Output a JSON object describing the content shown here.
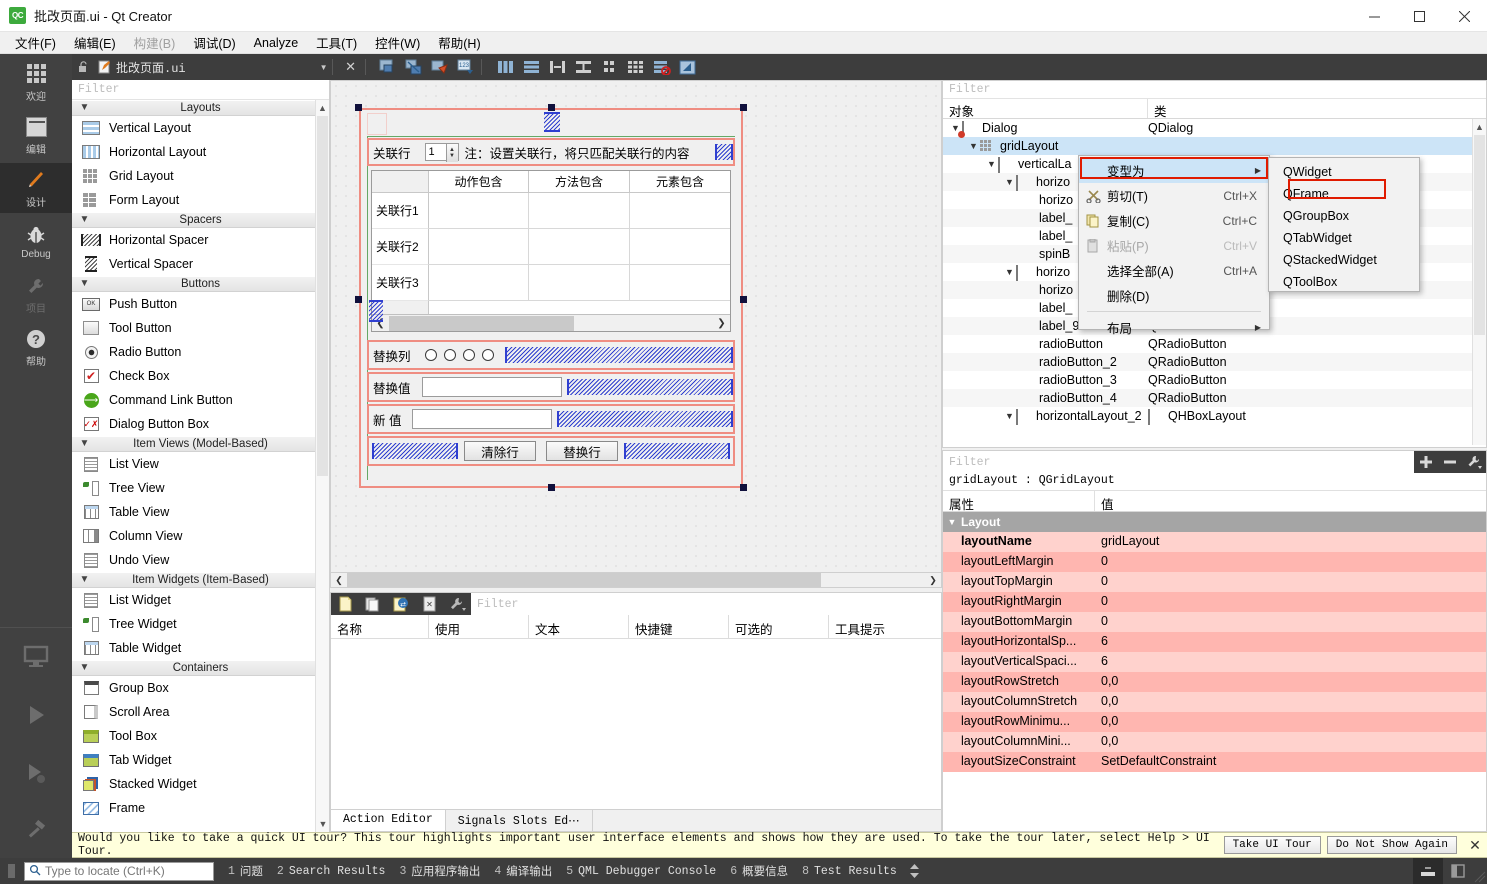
{
  "window": {
    "title": "批改页面.ui - Qt Creator",
    "logo_text": "QC",
    "minimize": "—",
    "maximize": "☐",
    "close": "✕"
  },
  "menubar": [
    {
      "label": "文件(F)",
      "disabled": false
    },
    {
      "label": "编辑(E)",
      "disabled": false
    },
    {
      "label": "构建(B)",
      "disabled": true
    },
    {
      "label": "调试(D)",
      "disabled": false
    },
    {
      "label": "Analyze",
      "disabled": false
    },
    {
      "label": "工具(T)",
      "disabled": false
    },
    {
      "label": "控件(W)",
      "disabled": false
    },
    {
      "label": "帮助(H)",
      "disabled": false
    }
  ],
  "activitybar": [
    {
      "label": "欢迎",
      "icon": "welcome-grid-icon",
      "state": "normal"
    },
    {
      "label": "编辑",
      "icon": "edit-lines-icon",
      "state": "normal"
    },
    {
      "label": "设计",
      "icon": "design-pencil-icon",
      "state": "selected"
    },
    {
      "label": "Debug",
      "icon": "debug-bug-icon",
      "state": "normal"
    },
    {
      "label": "项目",
      "icon": "projects-wrench-icon",
      "state": "dim"
    },
    {
      "label": "帮助",
      "icon": "help-question-icon",
      "state": "normal"
    }
  ],
  "activitybar_lower": [
    {
      "icon": "kit-selector-monitor-icon"
    },
    {
      "icon": "run-play-icon"
    },
    {
      "icon": "debug-start-icon"
    },
    {
      "icon": "build-hammer-icon"
    }
  ],
  "editor_toolbar": {
    "lock_icon": "lock-open-icon",
    "file_icon": "ui-file-icon",
    "filename": "批改页面.ui",
    "dropdown_icon": "chevron-down-icon",
    "close_icon": "close-icon",
    "tools": [
      "edit-widgets-icon",
      "edit-signals-slots-icon",
      "edit-buddies-icon",
      "edit-tab-order-icon",
      "layout-horizontally-icon",
      "layout-vertically-icon",
      "layout-splitter-h-icon",
      "layout-splitter-v-icon",
      "layout-form-icon",
      "layout-grid-icon",
      "break-layout-icon",
      "adjust-size-icon"
    ]
  },
  "widgetbox": {
    "filter_placeholder": "Filter",
    "groups": [
      {
        "title": "Layouts",
        "items": [
          {
            "label": "Vertical Layout",
            "icon": "vertical-layout-icon"
          },
          {
            "label": "Horizontal Layout",
            "icon": "horizontal-layout-icon"
          },
          {
            "label": "Grid Layout",
            "icon": "grid-layout-icon"
          },
          {
            "label": "Form Layout",
            "icon": "form-layout-icon"
          }
        ]
      },
      {
        "title": "Spacers",
        "items": [
          {
            "label": "Horizontal Spacer",
            "icon": "horizontal-spacer-icon"
          },
          {
            "label": "Vertical Spacer",
            "icon": "vertical-spacer-icon"
          }
        ]
      },
      {
        "title": "Buttons",
        "items": [
          {
            "label": "Push Button",
            "icon": "push-button-icon"
          },
          {
            "label": "Tool Button",
            "icon": "tool-button-icon"
          },
          {
            "label": "Radio Button",
            "icon": "radio-button-icon"
          },
          {
            "label": "Check Box",
            "icon": "check-box-icon"
          },
          {
            "label": "Command Link Button",
            "icon": "command-link-button-icon"
          },
          {
            "label": "Dialog Button Box",
            "icon": "dialog-button-box-icon"
          }
        ]
      },
      {
        "title": "Item Views (Model-Based)",
        "items": [
          {
            "label": "List View",
            "icon": "list-view-icon"
          },
          {
            "label": "Tree View",
            "icon": "tree-view-icon"
          },
          {
            "label": "Table View",
            "icon": "table-view-icon"
          },
          {
            "label": "Column View",
            "icon": "column-view-icon"
          },
          {
            "label": "Undo View",
            "icon": "undo-view-icon"
          }
        ]
      },
      {
        "title": "Item Widgets (Item-Based)",
        "items": [
          {
            "label": "List Widget",
            "icon": "list-widget-icon"
          },
          {
            "label": "Tree Widget",
            "icon": "tree-widget-icon"
          },
          {
            "label": "Table Widget",
            "icon": "table-widget-icon"
          }
        ]
      },
      {
        "title": "Containers",
        "items": [
          {
            "label": "Group Box",
            "icon": "group-box-icon"
          },
          {
            "label": "Scroll Area",
            "icon": "scroll-area-icon"
          },
          {
            "label": "Tool Box",
            "icon": "tool-box-icon"
          },
          {
            "label": "Tab Widget",
            "icon": "tab-widget-icon"
          },
          {
            "label": "Stacked Widget",
            "icon": "stacked-widget-icon"
          },
          {
            "label": "Frame",
            "icon": "frame-icon"
          }
        ]
      }
    ]
  },
  "form": {
    "row1": {
      "label": "关联行",
      "spin_value": "1",
      "note": "注：设置关联行，将只匹配关联行的内容"
    },
    "table": {
      "columns": [
        "",
        "动作包含",
        "方法包含",
        "元素包含"
      ],
      "rows": [
        "关联行1",
        "关联行2",
        "关联行3"
      ]
    },
    "replace_col": {
      "label": "替换列",
      "radio_count": 4
    },
    "replace_value": {
      "label": "替换值",
      "value": ""
    },
    "new_value": {
      "label": "新   值",
      "value": ""
    },
    "buttons": [
      {
        "label": "清除行"
      },
      {
        "label": "替换行"
      }
    ]
  },
  "action_editor": {
    "filter_placeholder": "Filter",
    "toolbar_icons": [
      "new-action-icon",
      "copy-action-icon",
      "edit-action-icon",
      "delete-action-icon",
      "view-options-icon"
    ],
    "columns": [
      "名称",
      "使用",
      "文本",
      "快捷键",
      "可选的",
      "工具提示"
    ],
    "tabs": [
      {
        "label": "Action Editor",
        "active": true
      },
      {
        "label": "Signals  Slots Ed⋯",
        "active": false
      }
    ]
  },
  "object_inspector": {
    "filter_placeholder": "Filter",
    "columns": [
      "对象",
      "类"
    ],
    "rows": [
      {
        "name": "Dialog",
        "class": "QDialog",
        "indent": 0,
        "expander": "∨",
        "icon": "dialog-icon",
        "state": "normal"
      },
      {
        "name": "gridLayout",
        "class": "",
        "indent": 1,
        "expander": "∨",
        "icon": "grid-layout-icon",
        "state": "selected"
      },
      {
        "name": "verticalLa",
        "class": "",
        "indent": 2,
        "expander": "∨",
        "icon": "vertical-layout-icon",
        "state": "normal"
      },
      {
        "name": "horizo",
        "class": "",
        "indent": 3,
        "expander": "∨",
        "icon": "horizontal-layout-icon",
        "state": "alt"
      },
      {
        "name": "horizo",
        "class": "",
        "indent": 4,
        "expander": "",
        "icon": "",
        "state": "normal"
      },
      {
        "name": "label_",
        "class": "",
        "indent": 4,
        "expander": "",
        "icon": "",
        "state": "alt"
      },
      {
        "name": "label_",
        "class": "",
        "indent": 4,
        "expander": "",
        "icon": "",
        "state": "normal"
      },
      {
        "name": "spinB",
        "class": "",
        "indent": 4,
        "expander": "",
        "icon": "",
        "state": "alt"
      },
      {
        "name": "horizo",
        "class": "",
        "indent": 3,
        "expander": "∨",
        "icon": "horizontal-layout-icon",
        "state": "normal"
      },
      {
        "name": "horizo",
        "class": "",
        "indent": 4,
        "expander": "",
        "icon": "",
        "state": "alt"
      },
      {
        "name": "label_",
        "class": "",
        "indent": 4,
        "expander": "",
        "icon": "",
        "state": "normal"
      },
      {
        "name": "label_9",
        "class": "QLabel",
        "indent": 4,
        "expander": "",
        "icon": "",
        "state": "alt"
      },
      {
        "name": "radioButton",
        "class": "QRadioButton",
        "indent": 4,
        "expander": "",
        "icon": "",
        "state": "normal"
      },
      {
        "name": "radioButton_2",
        "class": "QRadioButton",
        "indent": 4,
        "expander": "",
        "icon": "",
        "state": "alt"
      },
      {
        "name": "radioButton_3",
        "class": "QRadioButton",
        "indent": 4,
        "expander": "",
        "icon": "",
        "state": "normal"
      },
      {
        "name": "radioButton_4",
        "class": "QRadioButton",
        "indent": 4,
        "expander": "",
        "icon": "",
        "state": "alt"
      },
      {
        "name": "horizontalLayout_2",
        "class": "QHBoxLayout",
        "indent": 3,
        "expander": "∨",
        "icon": "horizontal-layout-icon",
        "state": "normal"
      }
    ]
  },
  "context_menu": {
    "items": [
      {
        "label": "变型为",
        "icon": "",
        "accel": "",
        "submenu": true,
        "highlighted": true,
        "disabled": false
      },
      {
        "label": "剪切(T)",
        "icon": "cut-scissors-icon",
        "accel": "Ctrl+X",
        "submenu": false,
        "highlighted": false,
        "disabled": false
      },
      {
        "label": "复制(C)",
        "icon": "copy-icon",
        "accel": "Ctrl+C",
        "submenu": false,
        "highlighted": false,
        "disabled": false
      },
      {
        "label": "粘贴(P)",
        "icon": "paste-icon",
        "accel": "Ctrl+V",
        "submenu": false,
        "highlighted": false,
        "disabled": true
      },
      {
        "label": "选择全部(A)",
        "icon": "",
        "accel": "Ctrl+A",
        "submenu": false,
        "highlighted": false,
        "disabled": false
      },
      {
        "label": "删除(D)",
        "icon": "",
        "accel": "",
        "submenu": false,
        "highlighted": false,
        "disabled": false
      },
      {
        "label": "布局",
        "icon": "",
        "accel": "",
        "submenu": true,
        "highlighted": false,
        "disabled": false
      }
    ],
    "submenu_items": [
      {
        "label": "QWidget",
        "highlighted": false
      },
      {
        "label": "QFrame",
        "highlighted": true
      },
      {
        "label": "QGroupBox",
        "highlighted": false
      },
      {
        "label": "QTabWidget",
        "highlighted": false
      },
      {
        "label": "QStackedWidget",
        "highlighted": false
      },
      {
        "label": "QToolBox",
        "highlighted": false
      }
    ],
    "highlight_color": "#e01b00"
  },
  "property_editor": {
    "filter_placeholder": "Filter",
    "add_icon": "plus-icon",
    "remove_icon": "minus-icon",
    "config_icon": "wrench-icon",
    "object_line": "gridLayout : QGridLayout",
    "columns": [
      "属性",
      "值"
    ],
    "group": "Layout",
    "rows": [
      {
        "key": "layoutName",
        "value": "gridLayout",
        "bold": true
      },
      {
        "key": "layoutLeftMargin",
        "value": "0",
        "bold": false
      },
      {
        "key": "layoutTopMargin",
        "value": "0",
        "bold": false
      },
      {
        "key": "layoutRightMargin",
        "value": "0",
        "bold": false
      },
      {
        "key": "layoutBottomMargin",
        "value": "0",
        "bold": false
      },
      {
        "key": "layoutHorizontalSp...",
        "value": "6",
        "bold": false
      },
      {
        "key": "layoutVerticalSpaci...",
        "value": "6",
        "bold": false
      },
      {
        "key": "layoutRowStretch",
        "value": "0,0",
        "bold": false
      },
      {
        "key": "layoutColumnStretch",
        "value": "0,0",
        "bold": false
      },
      {
        "key": "layoutRowMinimu...",
        "value": "0,0",
        "bold": false
      },
      {
        "key": "layoutColumnMini...",
        "value": "0,0",
        "bold": false
      },
      {
        "key": "layoutSizeConstraint",
        "value": "SetDefaultConstraint",
        "bold": false
      }
    ]
  },
  "tour_bar": {
    "message": "Would you like to take a quick UI tour? This tour highlights important user interface elements and shows how they are used. To take the tour later, select Help > UI Tour.",
    "take_button": "Take UI Tour",
    "dismiss_button": "Do Not Show Again",
    "close_icon": "close-icon"
  },
  "statusbar": {
    "locator_placeholder": "Type to locate (Ctrl+K)",
    "search_icon": "search-icon",
    "items": [
      {
        "num": "1",
        "label": "问题"
      },
      {
        "num": "2",
        "label": "Search Results"
      },
      {
        "num": "3",
        "label": "应用程序输出"
      },
      {
        "num": "4",
        "label": "编译输出"
      },
      {
        "num": "5",
        "label": "QML Debugger Console"
      },
      {
        "num": "6",
        "label": "概要信息"
      },
      {
        "num": "8",
        "label": "Test Results"
      }
    ],
    "updown_icon": "up-down-arrows-icon",
    "right_buttons": [
      "output-pane-icon",
      "sidebar-toggle-icon"
    ]
  }
}
